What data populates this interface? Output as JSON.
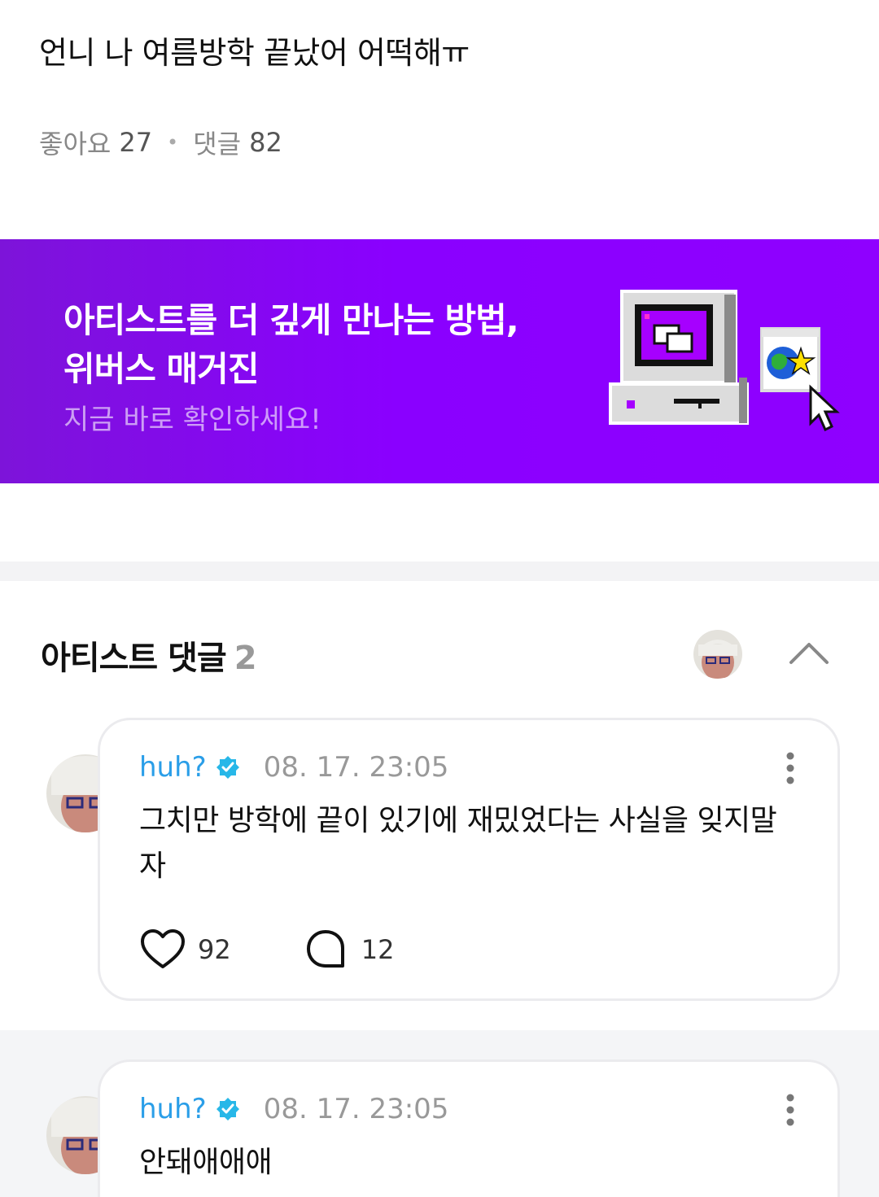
{
  "post": {
    "title": "언니 나 여름방학 끝났어 어떡해ㅠ",
    "likes_label": "좋아요",
    "likes_count": "27",
    "comments_label": "댓글",
    "comments_count": "82"
  },
  "banner": {
    "line1": "아티스트를 더 깊게 만나는 방법,",
    "line2": "위버스 매거진",
    "line3": "지금 바로 확인하세요!",
    "bg_color": "#8a00ff"
  },
  "artist_comments": {
    "heading": "아티스트 댓글",
    "count": "2"
  },
  "comments": [
    {
      "user": "huh?",
      "time": "08. 17. 23:05",
      "text": "그치만 방학에 끝이 있기에 재밌었다는 사실을 잊지말자",
      "likes": "92",
      "replies": "12"
    },
    {
      "user": "huh?",
      "time": "08. 17. 23:05",
      "text": "안돼애애애"
    }
  ],
  "colors": {
    "accent": "#2a9ee8",
    "verified": "#27b7e8"
  }
}
